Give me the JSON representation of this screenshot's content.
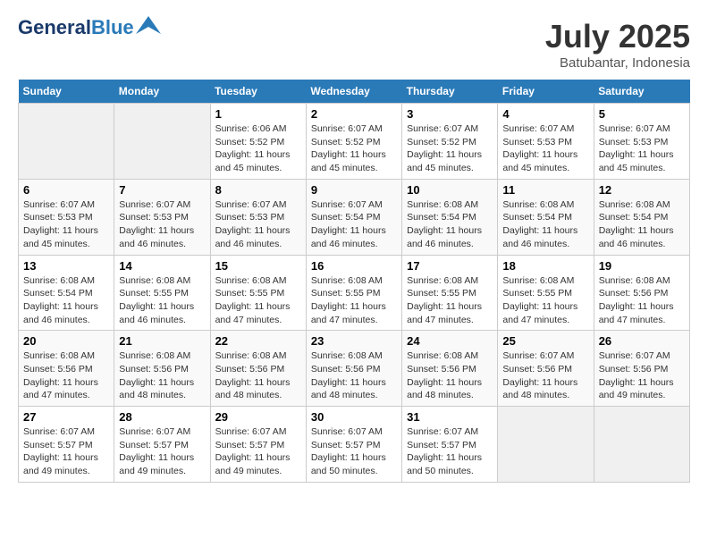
{
  "header": {
    "logo_line1": "General",
    "logo_line2": "Blue",
    "month_year": "July 2025",
    "location": "Batubantar, Indonesia"
  },
  "days_of_week": [
    "Sunday",
    "Monday",
    "Tuesday",
    "Wednesday",
    "Thursday",
    "Friday",
    "Saturday"
  ],
  "weeks": [
    [
      {
        "day": "",
        "sunrise": "",
        "sunset": "",
        "daylight": ""
      },
      {
        "day": "",
        "sunrise": "",
        "sunset": "",
        "daylight": ""
      },
      {
        "day": "1",
        "sunrise": "Sunrise: 6:06 AM",
        "sunset": "Sunset: 5:52 PM",
        "daylight": "Daylight: 11 hours and 45 minutes."
      },
      {
        "day": "2",
        "sunrise": "Sunrise: 6:07 AM",
        "sunset": "Sunset: 5:52 PM",
        "daylight": "Daylight: 11 hours and 45 minutes."
      },
      {
        "day": "3",
        "sunrise": "Sunrise: 6:07 AM",
        "sunset": "Sunset: 5:52 PM",
        "daylight": "Daylight: 11 hours and 45 minutes."
      },
      {
        "day": "4",
        "sunrise": "Sunrise: 6:07 AM",
        "sunset": "Sunset: 5:53 PM",
        "daylight": "Daylight: 11 hours and 45 minutes."
      },
      {
        "day": "5",
        "sunrise": "Sunrise: 6:07 AM",
        "sunset": "Sunset: 5:53 PM",
        "daylight": "Daylight: 11 hours and 45 minutes."
      }
    ],
    [
      {
        "day": "6",
        "sunrise": "Sunrise: 6:07 AM",
        "sunset": "Sunset: 5:53 PM",
        "daylight": "Daylight: 11 hours and 45 minutes."
      },
      {
        "day": "7",
        "sunrise": "Sunrise: 6:07 AM",
        "sunset": "Sunset: 5:53 PM",
        "daylight": "Daylight: 11 hours and 46 minutes."
      },
      {
        "day": "8",
        "sunrise": "Sunrise: 6:07 AM",
        "sunset": "Sunset: 5:53 PM",
        "daylight": "Daylight: 11 hours and 46 minutes."
      },
      {
        "day": "9",
        "sunrise": "Sunrise: 6:07 AM",
        "sunset": "Sunset: 5:54 PM",
        "daylight": "Daylight: 11 hours and 46 minutes."
      },
      {
        "day": "10",
        "sunrise": "Sunrise: 6:08 AM",
        "sunset": "Sunset: 5:54 PM",
        "daylight": "Daylight: 11 hours and 46 minutes."
      },
      {
        "day": "11",
        "sunrise": "Sunrise: 6:08 AM",
        "sunset": "Sunset: 5:54 PM",
        "daylight": "Daylight: 11 hours and 46 minutes."
      },
      {
        "day": "12",
        "sunrise": "Sunrise: 6:08 AM",
        "sunset": "Sunset: 5:54 PM",
        "daylight": "Daylight: 11 hours and 46 minutes."
      }
    ],
    [
      {
        "day": "13",
        "sunrise": "Sunrise: 6:08 AM",
        "sunset": "Sunset: 5:54 PM",
        "daylight": "Daylight: 11 hours and 46 minutes."
      },
      {
        "day": "14",
        "sunrise": "Sunrise: 6:08 AM",
        "sunset": "Sunset: 5:55 PM",
        "daylight": "Daylight: 11 hours and 46 minutes."
      },
      {
        "day": "15",
        "sunrise": "Sunrise: 6:08 AM",
        "sunset": "Sunset: 5:55 PM",
        "daylight": "Daylight: 11 hours and 47 minutes."
      },
      {
        "day": "16",
        "sunrise": "Sunrise: 6:08 AM",
        "sunset": "Sunset: 5:55 PM",
        "daylight": "Daylight: 11 hours and 47 minutes."
      },
      {
        "day": "17",
        "sunrise": "Sunrise: 6:08 AM",
        "sunset": "Sunset: 5:55 PM",
        "daylight": "Daylight: 11 hours and 47 minutes."
      },
      {
        "day": "18",
        "sunrise": "Sunrise: 6:08 AM",
        "sunset": "Sunset: 5:55 PM",
        "daylight": "Daylight: 11 hours and 47 minutes."
      },
      {
        "day": "19",
        "sunrise": "Sunrise: 6:08 AM",
        "sunset": "Sunset: 5:56 PM",
        "daylight": "Daylight: 11 hours and 47 minutes."
      }
    ],
    [
      {
        "day": "20",
        "sunrise": "Sunrise: 6:08 AM",
        "sunset": "Sunset: 5:56 PM",
        "daylight": "Daylight: 11 hours and 47 minutes."
      },
      {
        "day": "21",
        "sunrise": "Sunrise: 6:08 AM",
        "sunset": "Sunset: 5:56 PM",
        "daylight": "Daylight: 11 hours and 48 minutes."
      },
      {
        "day": "22",
        "sunrise": "Sunrise: 6:08 AM",
        "sunset": "Sunset: 5:56 PM",
        "daylight": "Daylight: 11 hours and 48 minutes."
      },
      {
        "day": "23",
        "sunrise": "Sunrise: 6:08 AM",
        "sunset": "Sunset: 5:56 PM",
        "daylight": "Daylight: 11 hours and 48 minutes."
      },
      {
        "day": "24",
        "sunrise": "Sunrise: 6:08 AM",
        "sunset": "Sunset: 5:56 PM",
        "daylight": "Daylight: 11 hours and 48 minutes."
      },
      {
        "day": "25",
        "sunrise": "Sunrise: 6:07 AM",
        "sunset": "Sunset: 5:56 PM",
        "daylight": "Daylight: 11 hours and 48 minutes."
      },
      {
        "day": "26",
        "sunrise": "Sunrise: 6:07 AM",
        "sunset": "Sunset: 5:56 PM",
        "daylight": "Daylight: 11 hours and 49 minutes."
      }
    ],
    [
      {
        "day": "27",
        "sunrise": "Sunrise: 6:07 AM",
        "sunset": "Sunset: 5:57 PM",
        "daylight": "Daylight: 11 hours and 49 minutes."
      },
      {
        "day": "28",
        "sunrise": "Sunrise: 6:07 AM",
        "sunset": "Sunset: 5:57 PM",
        "daylight": "Daylight: 11 hours and 49 minutes."
      },
      {
        "day": "29",
        "sunrise": "Sunrise: 6:07 AM",
        "sunset": "Sunset: 5:57 PM",
        "daylight": "Daylight: 11 hours and 49 minutes."
      },
      {
        "day": "30",
        "sunrise": "Sunrise: 6:07 AM",
        "sunset": "Sunset: 5:57 PM",
        "daylight": "Daylight: 11 hours and 50 minutes."
      },
      {
        "day": "31",
        "sunrise": "Sunrise: 6:07 AM",
        "sunset": "Sunset: 5:57 PM",
        "daylight": "Daylight: 11 hours and 50 minutes."
      },
      {
        "day": "",
        "sunrise": "",
        "sunset": "",
        "daylight": ""
      },
      {
        "day": "",
        "sunrise": "",
        "sunset": "",
        "daylight": ""
      }
    ]
  ]
}
